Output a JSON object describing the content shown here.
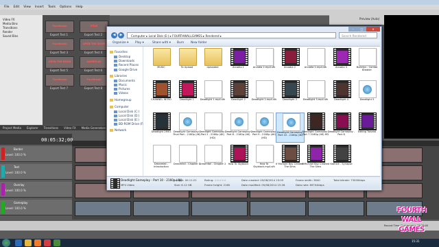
{
  "vegas": {
    "menu": [
      "File",
      "Edit",
      "View",
      "Insert",
      "Tools",
      "Options",
      "Help"
    ],
    "explorer_tree": [
      "Video FX",
      "Media Bins",
      "Transitions",
      "Render",
      "Sound Bins"
    ],
    "media_thumbs": [
      {
        "caption": "Fourthwall",
        "label": "Export Test 1"
      },
      {
        "caption": "TITLE",
        "label": "Export Test 2"
      },
      {
        "caption": "Fourthwall",
        "label": "Export Test 3"
      },
      {
        "caption": "OPEN THE DOOR",
        "label": "Export Test 4"
      },
      {
        "caption": "OPEN THE DOOR",
        "label": "Export Test 5"
      },
      {
        "caption": "GAMEPLAY",
        "label": "Export Test 6"
      },
      {
        "caption": "Fourthwall",
        "label": "Export Test 7"
      },
      {
        "caption": "Fourthwall",
        "label": "Export Test 8"
      }
    ],
    "tabs": [
      "Project Media",
      "Explorer",
      "Transitions",
      "Video FX",
      "Media Generators"
    ],
    "timecode": "00:05:32;00",
    "tracks": [
      {
        "name": "Border",
        "level": "Level: 100.0 %",
        "color": "#c22"
      },
      {
        "name": "Text",
        "level": "Level: 100.0 %",
        "color": "#2aa"
      },
      {
        "name": "Overlay",
        "level": "Level: 100.0 %",
        "color": "#a2a"
      },
      {
        "name": "Gameplay",
        "level": "Level: 100.0 %",
        "color": "#2a2"
      }
    ],
    "preview_label": "Preview (Auto)",
    "record_time": "Record Time (2 channels): 76:28:00",
    "watermark": [
      "FOURTH",
      "WALL",
      "GAMES"
    ]
  },
  "explorer": {
    "address": "Computer ▸ Local Disk (E:) ▸ FOURTHWALLGAMES ▸ Rendered ▸",
    "search_placeholder": "Search Rendered",
    "commands": [
      "Organize ▾",
      "Play ▾",
      "Share with ▾",
      "Burn",
      "New folder"
    ],
    "nav": [
      {
        "label": "Favorites",
        "group": true
      },
      {
        "label": "Desktop"
      },
      {
        "label": "Downloads"
      },
      {
        "label": "Recent Places"
      },
      {
        "label": "Google Drive"
      },
      {
        "label": "Libraries",
        "group": true
      },
      {
        "label": "Documents"
      },
      {
        "label": "Music"
      },
      {
        "label": "Pictures"
      },
      {
        "label": "Videos"
      },
      {
        "label": "Homegroup",
        "group": true
      },
      {
        "label": "Computer",
        "group": true
      },
      {
        "label": "Local Disk (C:)"
      },
      {
        "label": "Local Disk (D:)"
      },
      {
        "label": "Local Disk (E:)"
      },
      {
        "label": "BD-ROM Drive (F:)"
      },
      {
        "label": "Network",
        "group": true
      }
    ],
    "files": [
      {
        "name": "MUSIC",
        "kind": "folder"
      },
      {
        "name": "To Upload",
        "kind": "folder"
      },
      {
        "name": "Uploaded",
        "kind": "folder"
      },
      {
        "name": "Arcadia 1",
        "kind": "video",
        "tint": "#7b1fa2"
      },
      {
        "name": "Arcadia 2.mp4.sfk",
        "kind": "doc"
      },
      {
        "name": "Arcadia 2",
        "kind": "video",
        "tint": "#8a1c3c"
      },
      {
        "name": "Arcadia 2.mp4.sfk",
        "kind": "doc"
      },
      {
        "name": "Arcadia 3",
        "kind": "video",
        "tint": "#9c27b0"
      },
      {
        "name": "Bulletys - Combo Breaker",
        "kind": "doc"
      },
      {
        "name": "CHANNEL INTRO",
        "kind": "video",
        "tint": "#a0522d"
      },
      {
        "name": "Deadlight 1",
        "kind": "video",
        "tint": "#c2185b"
      },
      {
        "name": "Deadlight 1.mp4.sfk",
        "kind": "doc"
      },
      {
        "name": "Deadlight 2",
        "kind": "video",
        "tint": "#5d4037"
      },
      {
        "name": "Deadlight 2.mp4.sfk",
        "kind": "doc"
      },
      {
        "name": "Deadlight 3",
        "kind": "video",
        "tint": "#37474f"
      },
      {
        "name": "Deadlight 3.mp4.sfk",
        "kind": "doc"
      },
      {
        "name": "Deadlight 4",
        "kind": "video",
        "tint": "#4e342e"
      },
      {
        "name": "Deadlight 5",
        "kind": "play"
      },
      {
        "name": "Deadlight 2M01",
        "kind": "video",
        "tint": "#263238"
      },
      {
        "name": "Deadlight Gameplay - Final Part - 2160p (4K)",
        "kind": "play"
      },
      {
        "name": "Deadlight Gameplay - Part 2 - 2160p (4K)(HD)",
        "kind": "doc"
      },
      {
        "name": "Deadlight Gameplay - Part 8 - 2160p (4K)",
        "kind": "play"
      },
      {
        "name": "Deadlight Gameplay - Part 9 - 2160p (4K)(HD)",
        "kind": "play"
      },
      {
        "name": "Deadlight Gameplay - Part 10 - 2160p (4K)",
        "kind": "play",
        "selected": true
      },
      {
        "name": "Deadlight Gameplay - Part 7 2160p (4K) HD",
        "kind": "video",
        "tint": "#3e2723"
      },
      {
        "name": "Deadlight Gameplay - Part 8",
        "kind": "video",
        "tint": "#880e4f"
      },
      {
        "name": "Editing Tutorial",
        "kind": "video",
        "tint": "#6a1b9a"
      },
      {
        "name": "Dreamfall - Introduction",
        "kind": "doc"
      },
      {
        "name": "Dreamfall - Chapter 1",
        "kind": "doc"
      },
      {
        "name": "Dreamfall - Chapter 2",
        "kind": "doc"
      },
      {
        "name": "How To Skyblock",
        "kind": "video",
        "tint": "#ad1457"
      },
      {
        "name": "How To Skyblock.mp4.sfk",
        "kind": "doc"
      },
      {
        "name": "If Michael Bay Created The Sims",
        "kind": "video",
        "tint": "#6d4c41"
      },
      {
        "name": "If Michael Bay Created The Sims",
        "kind": "video",
        "tint": "#8e24aa"
      },
      {
        "name": "Kathick - Synapse",
        "kind": "video",
        "tint": "#424242"
      }
    ],
    "details": {
      "name": "Deadlight Gameplay - Part 10 - 2160p (4K)",
      "type": "MP4 Video",
      "length": "Length: 00:11:22",
      "size": "Size: 6.12 GB",
      "rating": "Rating: ☆☆☆☆☆",
      "frame": "Frame height: 2160",
      "date_created": "Date created: 05/08/2014 15:05",
      "date_modified": "Date modified: 05/08/2014 15:26",
      "frame_width": "Frame width: 3840",
      "data_rate": "Data rate: 69704kbps",
      "bitrate": "Total bitrate: 73000kbps"
    }
  },
  "taskbar": {
    "clock": "15:31"
  }
}
